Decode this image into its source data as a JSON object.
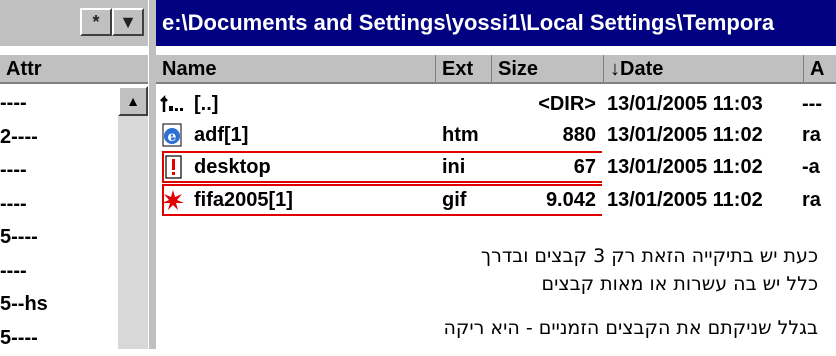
{
  "left_pane": {
    "star_label": "*",
    "dropdown_label": "▼",
    "header": "Attr",
    "rows": [
      "----",
      "2----",
      "----",
      "----",
      "5----",
      "----",
      "5--hs",
      "5----"
    ],
    "scroll_up_glyph": "▲"
  },
  "right_pane": {
    "path": "e:\\Documents and Settings\\yossi1\\Local Settings\\Tempora",
    "columns": {
      "name": "Name",
      "ext": "Ext",
      "size": "Size",
      "date": "↓Date",
      "attr": "A"
    },
    "files": [
      {
        "icon": "parent-folder-icon",
        "name": "[..]",
        "ext": "",
        "size": "<DIR>",
        "date": "13/01/2005 11:03",
        "attr": "---"
      },
      {
        "icon": "ie-html-icon",
        "name": "adf[1]",
        "ext": "htm",
        "size": "880",
        "date": "13/01/2005 11:02",
        "attr": "ra"
      },
      {
        "icon": "ini-file-icon",
        "name": "desktop",
        "ext": "ini",
        "size": "67",
        "date": "13/01/2005 11:02",
        "attr": "-a"
      },
      {
        "icon": "gif-image-icon",
        "name": "fifa2005[1]",
        "ext": "gif",
        "size": "9.042",
        "date": "13/01/2005 11:02",
        "attr": "ra"
      }
    ],
    "annotation": {
      "color": "#e00000",
      "note1": "כעת יש בתיקייה הזאת רק 3 קבצים ובדרך כלל יש בה עשרות או מאות קבצים",
      "note2": "בגלל שניקתם את הקבצים הזמניים - היא ריקה"
    }
  },
  "colors": {
    "title_bar": "#000080",
    "chrome": "#c0c0c0"
  }
}
